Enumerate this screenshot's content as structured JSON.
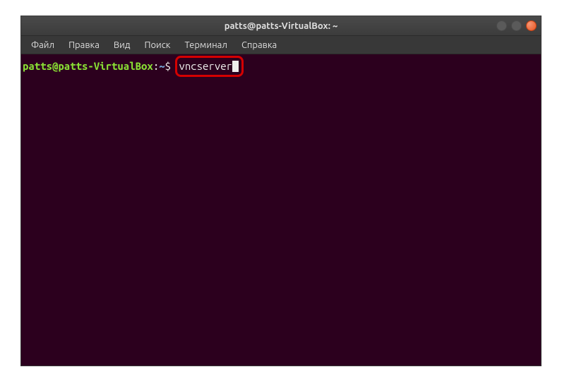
{
  "window": {
    "title": "patts@patts-VirtualBox: ~"
  },
  "menubar": {
    "items": [
      {
        "label": "Файл"
      },
      {
        "label": "Правка"
      },
      {
        "label": "Вид"
      },
      {
        "label": "Поиск"
      },
      {
        "label": "Терминал"
      },
      {
        "label": "Справка"
      }
    ]
  },
  "terminal": {
    "prompt_user_host": "patts@patts-VirtualBox",
    "prompt_colon": ":",
    "prompt_path": "~",
    "prompt_dollar": "$ ",
    "command": "vncserver"
  }
}
